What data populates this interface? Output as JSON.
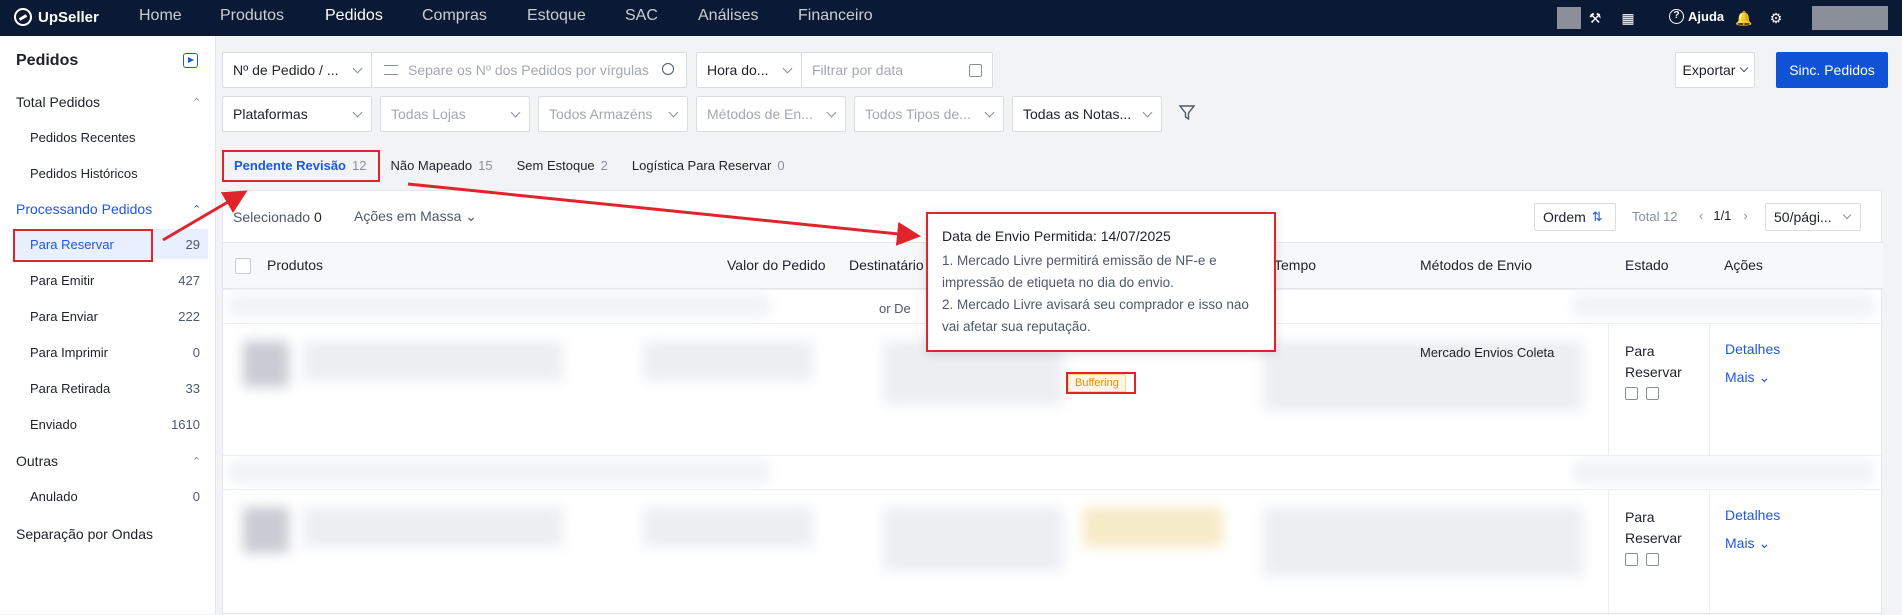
{
  "app": {
    "name": "UpSeller"
  },
  "nav": [
    "Home",
    "Produtos",
    "Pedidos",
    "Compras",
    "Estoque",
    "SAC",
    "Análises",
    "Financeiro"
  ],
  "nav_active": "Pedidos",
  "topright": {
    "help": "Ajuda"
  },
  "sidebar": {
    "title": "Pedidos",
    "groups": [
      {
        "label": "Total Pedidos",
        "items": [
          {
            "label": "Pedidos Recentes",
            "count": ""
          },
          {
            "label": "Pedidos Históricos",
            "count": ""
          }
        ]
      },
      {
        "label": "Processando Pedidos",
        "items": [
          {
            "label": "Para Reservar",
            "count": "29"
          },
          {
            "label": "Para Emitir",
            "count": "427"
          },
          {
            "label": "Para Enviar",
            "count": "222"
          },
          {
            "label": "Para Imprimir",
            "count": "0"
          },
          {
            "label": "Para Retirada",
            "count": "33"
          },
          {
            "label": "Enviado",
            "count": "1610"
          }
        ]
      },
      {
        "label": "Outras",
        "items": [
          {
            "label": "Anulado",
            "count": "0"
          }
        ]
      }
    ],
    "extra": "Separação por Ondas"
  },
  "filters": {
    "order_type": "Nº de Pedido / ...",
    "search_placeholder": "Separe os Nº dos Pedidos por vírgulas",
    "time_type": "Hora do...",
    "date_placeholder": "Filtrar por data",
    "platforms": "Plataformas",
    "stores": "Todas Lojas",
    "warehouses": "Todos Armazéns",
    "shipping": "Métodos de En...",
    "types": "Todos Tipos de...",
    "notes": "Todas as Notas...",
    "export": "Exportar",
    "sync": "Sinc. Pedidos"
  },
  "tabs": [
    {
      "label": "Pendente Revisão",
      "count": "12"
    },
    {
      "label": "Não Mapeado",
      "count": "15"
    },
    {
      "label": "Sem Estoque",
      "count": "2"
    },
    {
      "label": "Logística Para Reservar",
      "count": "0"
    }
  ],
  "toolbar": {
    "selected_label": "Selecionado",
    "selected_count": "0",
    "mass_actions": "Ações em Massa",
    "order": "Ordem",
    "total": "Total 12",
    "page": "1/1",
    "per_page": "50/pági..."
  },
  "table": {
    "headers": [
      "Produtos",
      "Valor do Pedido",
      "Destinatário",
      "Tempo",
      "Métodos de Envio",
      "Estado",
      "Ações"
    ],
    "group_text": "or De",
    "shipping_text": "Mercado Envios Coleta",
    "rows": [
      {
        "state": "Para Reservar",
        "details": "Detalhes",
        "more": "Mais",
        "tag": "Buffering"
      },
      {
        "state": "Para Reservar",
        "details": "Detalhes",
        "more": "Mais",
        "tag": ""
      }
    ]
  },
  "tooltip": {
    "title": "Data de Envio Permitida: 14/07/2025",
    "line1": "1. Mercado Livre permitirá emissão de NF-e e",
    "line2": "impressão de etiqueta no dia do envio.",
    "line3": "2. Mercado Livre avisará seu comprador e isso nao",
    "line4": "vai afetar sua reputação."
  },
  "colors": {
    "accent": "#1f58dd",
    "primary_button": "#0f52d6",
    "topbar": "#0b1a34",
    "annotation": "#e0242b",
    "buffer_tag": "#ea8a00"
  }
}
